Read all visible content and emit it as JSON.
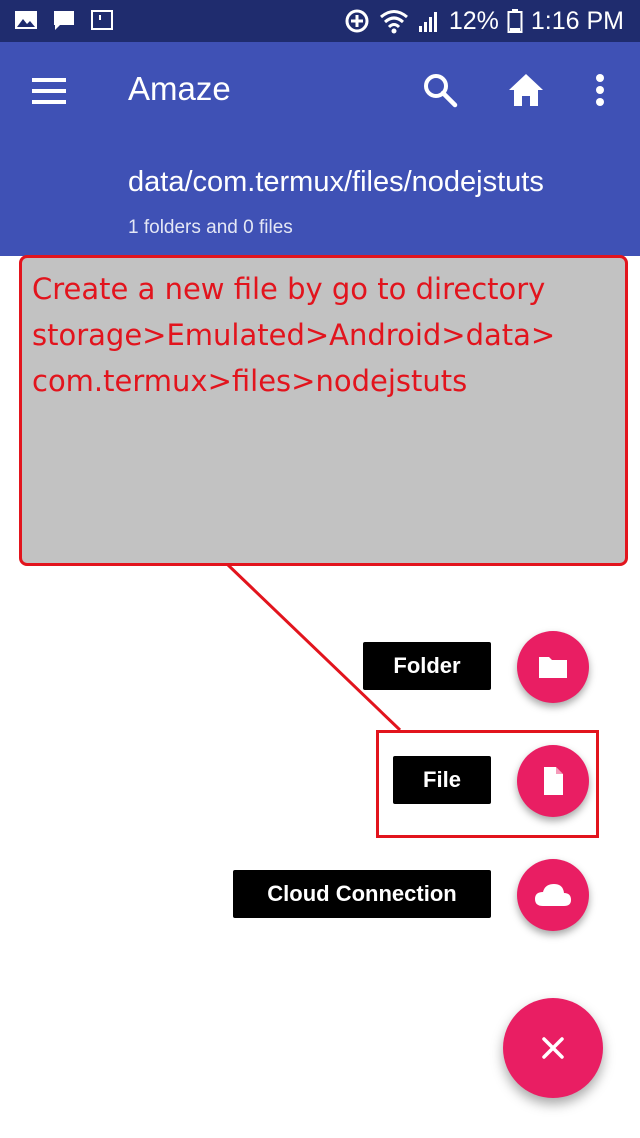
{
  "status_bar": {
    "battery": "12%",
    "time": "1:16 PM",
    "icons": [
      "image-icon",
      "message-icon",
      "notification-icon",
      "data-saver-icon",
      "wifi-icon",
      "signal-icon",
      "battery-icon"
    ]
  },
  "app_bar": {
    "title": "Amaze",
    "path": "data/com.termux/files/nodejstuts",
    "item_count": "1 folders and 0 files",
    "icons": [
      "menu-icon",
      "search-icon",
      "home-icon",
      "more-vert-icon"
    ]
  },
  "annotation": {
    "line1": "Create a new file by go to directory",
    "line2": "storage>Emulated>Android>data>",
    "line3": "com.termux>files>nodejstuts"
  },
  "fab_menu": {
    "folder_label": "Folder",
    "file_label": "File",
    "cloud_label": "Cloud Connection",
    "icons": [
      "folder-icon",
      "file-icon",
      "cloud-icon",
      "close-icon"
    ]
  },
  "colors": {
    "status_bar": "#1f2c6e",
    "app_bar": "#3f51b5",
    "accent": "#e91e63",
    "annotation_red": "#e2141d"
  }
}
